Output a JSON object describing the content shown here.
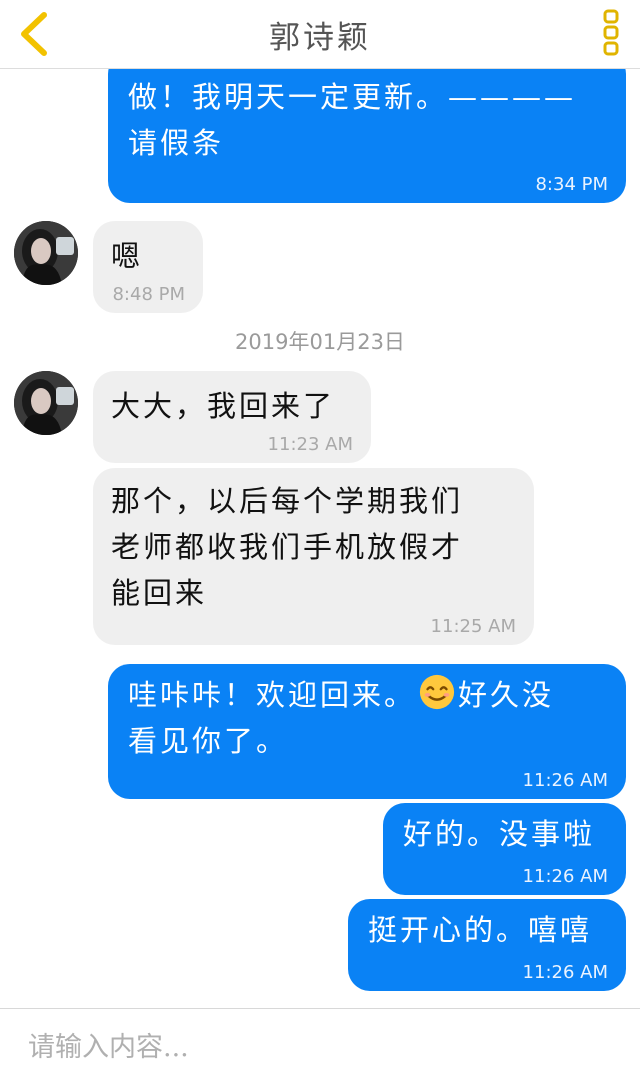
{
  "header": {
    "title": "郭诗颖",
    "back_icon": "chevron-left-icon",
    "menu_icon": "more-vertical-icon",
    "accent_color": "#f2c200"
  },
  "colors": {
    "outgoing_bubble": "#0a82f5",
    "incoming_bubble": "#efefef"
  },
  "date_separator": "2019年01月23日",
  "messages": [
    {
      "direction": "out",
      "text": "做！我明天一定更新。————\n请假条",
      "time": "8:34 PM"
    },
    {
      "direction": "in",
      "text": "嗯",
      "time": "8:48 PM"
    },
    {
      "direction": "in",
      "text": "大大，我回来了",
      "time": "11:23 AM"
    },
    {
      "direction": "in",
      "text": "那个，以后每个学期我们\n老师都收我们手机放假才\n能回来",
      "time": "11:25 AM"
    },
    {
      "direction": "out",
      "text_before_emoji": "哇咔咔！欢迎回来。",
      "emoji": "smiling-face-emoji",
      "text_after_emoji": "好久没\n看见你了。",
      "time": "11:26 AM"
    },
    {
      "direction": "out",
      "text": "好的。没事啦",
      "time": "11:26 AM"
    },
    {
      "direction": "out",
      "text": "挺开心的。嘻嘻",
      "time": "11:26 AM"
    }
  ],
  "input": {
    "placeholder": "请输入内容..."
  }
}
